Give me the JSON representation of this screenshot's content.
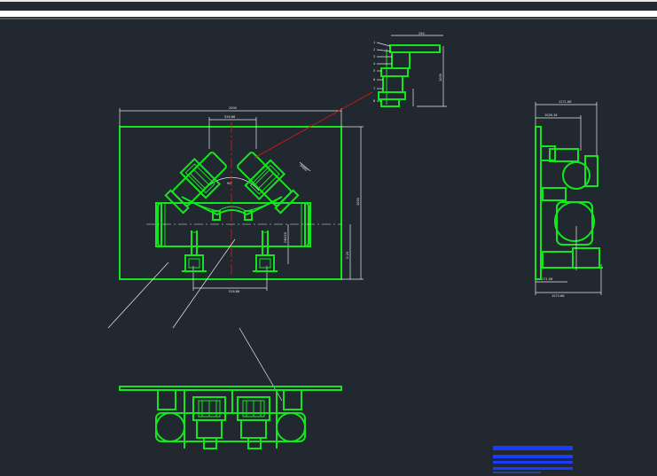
{
  "drawing": {
    "background_color": "#212830",
    "line_color": "#14e61e",
    "dimension_color": "#e8e8e8",
    "centerline_color": "#e01818",
    "title_block_color": "#1a3cff"
  },
  "dimensions": {
    "front_overall_width": "2000",
    "front_spacing_top": "526.86",
    "front_spacing_bottom": "526.86",
    "front_angle": "90°",
    "front_nozzle": "DN80",
    "front_right_height": "1000",
    "front_pipe": "DN150",
    "front_lower": "D 20",
    "side_top": "1271.66",
    "side_upper": "1026.16",
    "side_lower": "271.56",
    "side_bottom": "1073.66",
    "detail_top": "250",
    "detail_height": "1000"
  },
  "detail_callouts": [
    "1",
    "2",
    "3",
    "4",
    "5",
    "6",
    "7",
    "8"
  ],
  "title_block_rows": [
    "",
    "",
    "",
    ""
  ]
}
